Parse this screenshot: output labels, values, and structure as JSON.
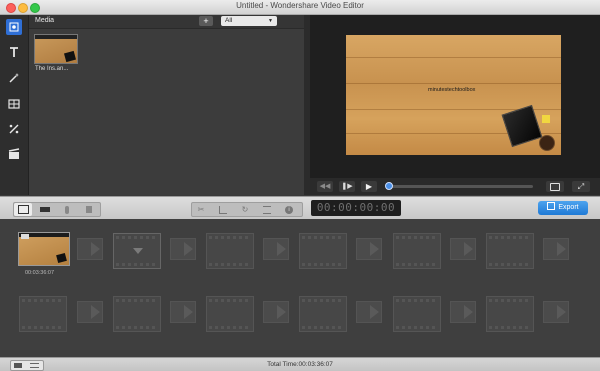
{
  "window": {
    "title": "Untitled - Wondershare Video Editor"
  },
  "sidebar": {
    "icons": [
      "media-icon",
      "text-icon",
      "effects-icon",
      "transitions-icon",
      "elements-icon",
      "intro-credit-icon"
    ]
  },
  "media": {
    "title": "Media",
    "add_label": "+",
    "filter_value": "All",
    "items": [
      {
        "label": "The Ins.an..."
      }
    ]
  },
  "preview": {
    "overlay_text": "minutestechtoolbox",
    "controls": [
      "rewind-icon",
      "play-pause-icon",
      "play-icon"
    ],
    "progress": 0.0
  },
  "toolbar": {
    "timecode": "00:00:00:00",
    "export_label": "Export"
  },
  "timeline": {
    "clips": [
      {
        "duration": "00:03:36:07"
      }
    ]
  },
  "status": {
    "total_time": "Total Time:00:03:36:07"
  },
  "colors": {
    "accent": "#1f7ad6",
    "wood": "#d09a55"
  }
}
